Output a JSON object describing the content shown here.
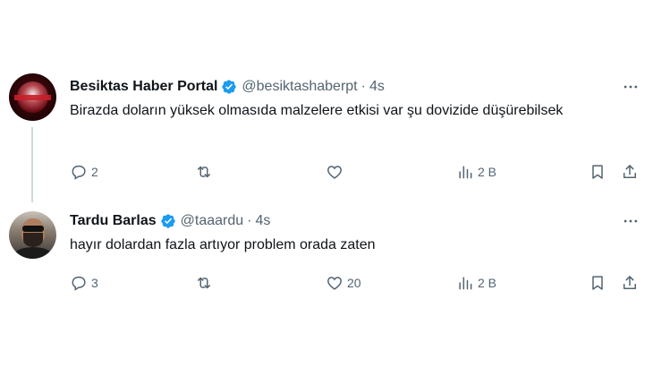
{
  "tweets": [
    {
      "author_name": "Besiktas Haber Portal",
      "handle": "@besiktashaberpt",
      "separator": "·",
      "time": "4s",
      "text": "Birazda doların yüksek olmasıda malzelere etkisi var şu dovizide düşürebilsek",
      "replies": "2",
      "reposts": "",
      "likes": "",
      "views": "2 B",
      "avatar_icon": "club-logo",
      "verified_color": "#1d9bf0"
    },
    {
      "author_name": "Tardu Barlas",
      "handle": "@taaardu",
      "separator": "·",
      "time": "4s",
      "text": "hayır dolardan fazla artıyor problem orada zaten",
      "replies": "3",
      "reposts": "",
      "likes": "20",
      "views": "2 B",
      "avatar_icon": "profile-photo",
      "verified_color": "#1d9bf0"
    }
  ],
  "colors": {
    "text_primary": "#0f1419",
    "text_secondary": "#536471",
    "verified": "#1d9bf0",
    "thread_line": "#cfd9de"
  }
}
